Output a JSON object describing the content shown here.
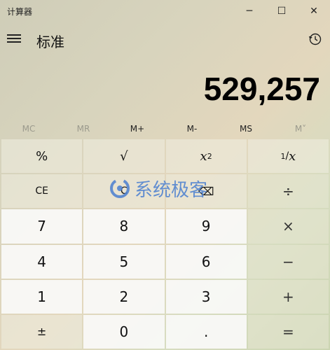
{
  "window": {
    "app_title": "计算器",
    "min_glyph": "─",
    "max_glyph": "☐",
    "close_glyph": "✕"
  },
  "header": {
    "mode_title": "标准"
  },
  "display": {
    "value": "529,257"
  },
  "memory": [
    {
      "label": "MC",
      "enabled": false
    },
    {
      "label": "MR",
      "enabled": false
    },
    {
      "label": "M+",
      "enabled": true
    },
    {
      "label": "M-",
      "enabled": true
    },
    {
      "label": "MS",
      "enabled": true
    },
    {
      "label": "M˅",
      "enabled": false
    }
  ],
  "keys": {
    "percent": "%",
    "sqrt": "√",
    "square_base": "x",
    "square_exp": "2",
    "reciprocal_num": "1",
    "reciprocal_den": "x",
    "ce": "CE",
    "c": "C",
    "backspace": "⌫",
    "divide": "÷",
    "seven": "7",
    "eight": "8",
    "nine": "9",
    "multiply": "×",
    "four": "4",
    "five": "5",
    "six": "6",
    "minus": "−",
    "one": "1",
    "two": "2",
    "three": "3",
    "plus": "+",
    "negate": "±",
    "zero": "0",
    "decimal": ".",
    "equals": "="
  },
  "watermark": {
    "text": "系统极客"
  },
  "colors": {
    "watermark_blue": "#4a7fd0"
  }
}
